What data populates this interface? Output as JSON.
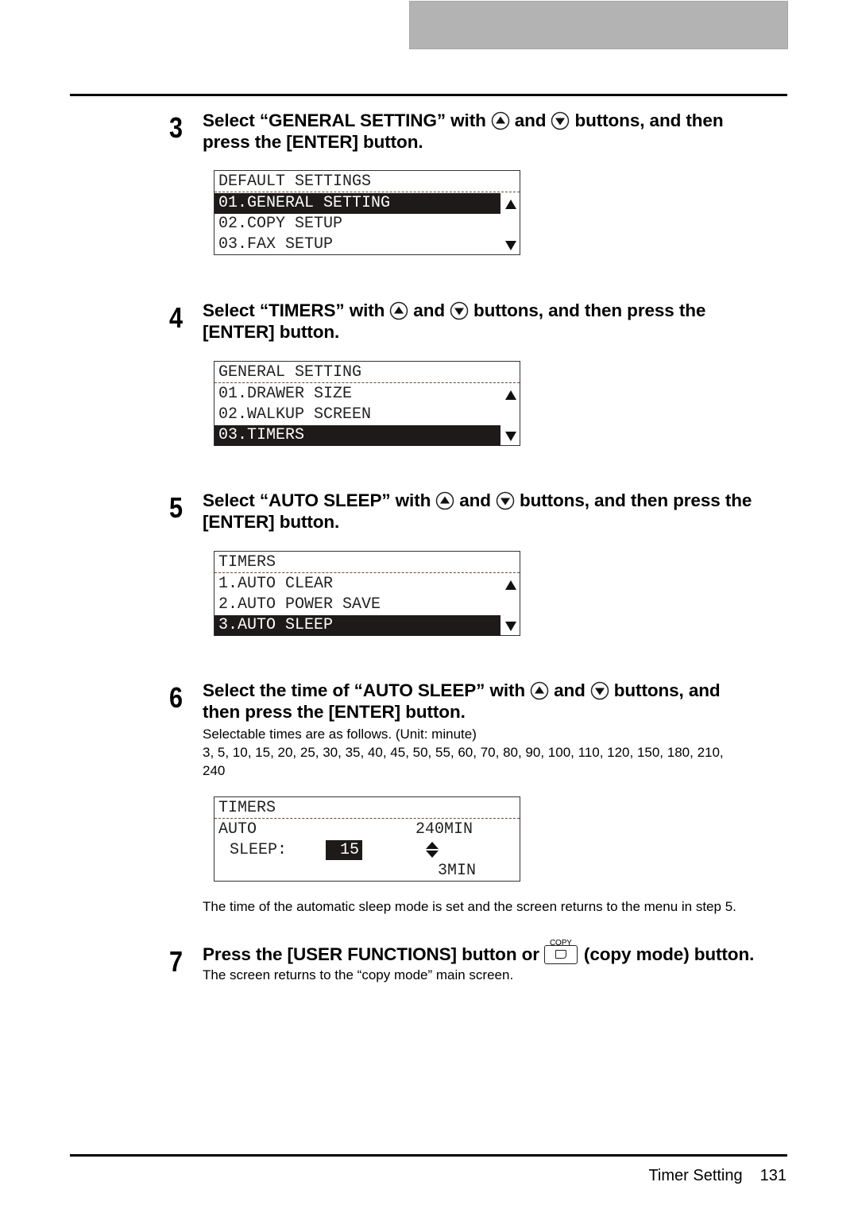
{
  "header": {
    "tab_color": "#b3b3b3"
  },
  "steps": [
    {
      "number": "3",
      "title_parts": [
        "Select “GENERAL SETTING” with",
        "and",
        "buttons, and then",
        "press the [ENTER] button."
      ],
      "lcd": {
        "title": "DEFAULT SETTINGS",
        "items": [
          "01.GENERAL SETTING",
          "02.COPY SETUP",
          "03.FAX SETUP"
        ],
        "selected_index": 0
      }
    },
    {
      "number": "4",
      "title_parts": [
        "Select “TIMERS” with",
        "and",
        "buttons, and then press the",
        "[ENTER] button."
      ],
      "lcd": {
        "title": "GENERAL SETTING",
        "items": [
          "01.DRAWER SIZE",
          "02.WALKUP SCREEN",
          "03.TIMERS"
        ],
        "selected_index": 2
      }
    },
    {
      "number": "5",
      "title_parts": [
        "Select “AUTO SLEEP” with",
        "and",
        "buttons, and then press the",
        "[ENTER] button."
      ],
      "lcd": {
        "title": "TIMERS",
        "items": [
          "1.AUTO CLEAR",
          "2.AUTO POWER SAVE",
          "3.AUTO SLEEP"
        ],
        "selected_index": 2
      }
    },
    {
      "number": "6",
      "title_parts": [
        "Select the time of “AUTO SLEEP” with",
        "and",
        "buttons, and",
        "then press the [ENTER] button."
      ],
      "note": "Selectable times are as follows. (Unit: minute)",
      "values_line1": "3, 5, 10, 15, 20, 25, 30, 35, 40, 45, 50, 55, 60, 70, 80, 90, 100, 110, 120, 150, 180, 210,",
      "values_line2": "240",
      "lcd": {
        "title": "TIMERS",
        "label_line1": "AUTO",
        "label_line2": "SLEEP:",
        "current_value": "15",
        "max_label": "240MIN",
        "min_label": "3MIN"
      },
      "result": "The time of the automatic sleep mode is set and the screen returns to the menu in step 5."
    },
    {
      "number": "7",
      "title_before": "Press the [USER FUNCTIONS] button or",
      "key_label": "COPY",
      "title_after": "(copy mode) button.",
      "result": "The screen returns to the “copy mode” main screen."
    }
  ],
  "icons": {
    "up": "up-arrow-button-icon",
    "down": "down-arrow-button-icon",
    "copy": "copy-mode-key-icon"
  },
  "footer": {
    "section": "Timer Setting",
    "page": "131"
  }
}
